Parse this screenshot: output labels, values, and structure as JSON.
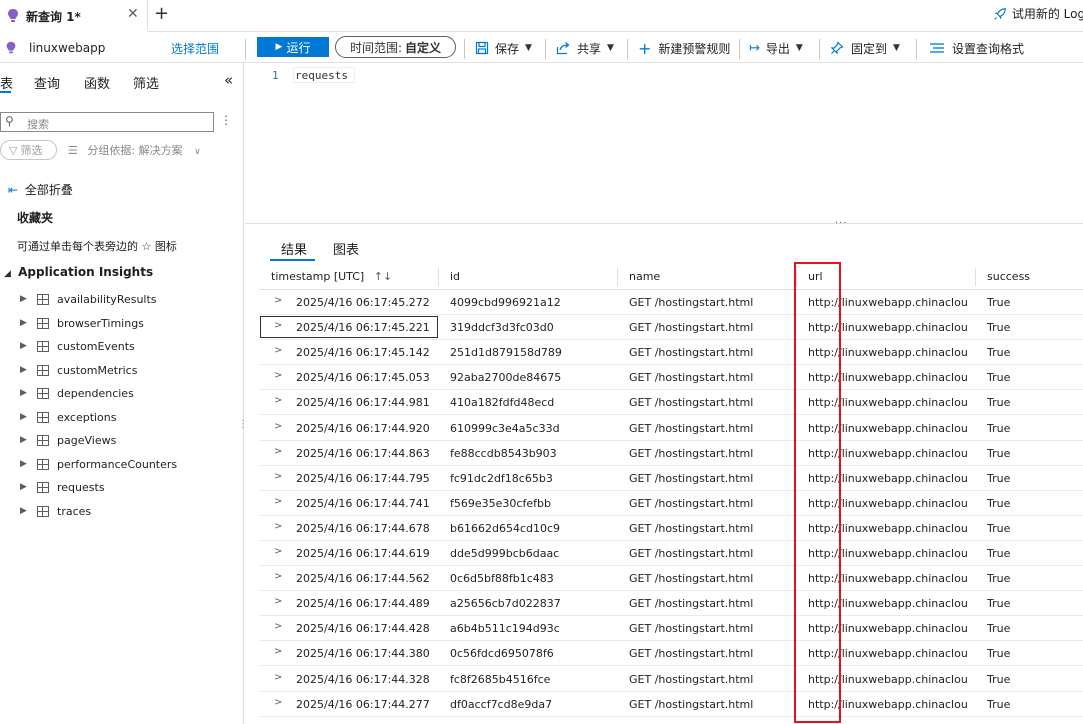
{
  "tabbar": {
    "tab_title": "新查询 1*",
    "close_glyph": "✕",
    "add_glyph": "+",
    "try_new": "试用新的 Log"
  },
  "toolbar": {
    "scope": "linuxwebapp",
    "select_scope": "选择范围",
    "run": "运行",
    "time_range_label": "时间范围:",
    "time_range_value": "自定义",
    "save": "保存",
    "share": "共享",
    "new_alert": "新建预警规则",
    "export": "导出",
    "pin": "固定到",
    "format": "设置查询格式"
  },
  "left": {
    "tabs": [
      "表",
      "查询",
      "函数",
      "筛选"
    ],
    "collapse_glyph": "«",
    "search_placeholder": "搜索",
    "filter": "筛选",
    "group_by": "分组依据: 解决方案",
    "collapse_all": "全部折叠",
    "favorites_title": "收藏夹",
    "favorites_hint": "可通过单击每个表旁边的 ☆ 图标",
    "section": "Application Insights",
    "tables": [
      "availabilityResults",
      "browserTimings",
      "customEvents",
      "customMetrics",
      "dependencies",
      "exceptions",
      "pageViews",
      "performanceCounters",
      "requests",
      "traces"
    ]
  },
  "editor": {
    "line_number": "1",
    "code": "requests"
  },
  "results": {
    "tabs": [
      "结果",
      "图表"
    ],
    "columns": [
      "timestamp [UTC]",
      "id",
      "name",
      "url",
      "success"
    ],
    "sort_glyph": "↑↓",
    "rows": [
      [
        "2025/4/16 06:17:45.272",
        "4099cbd996921a12",
        "GET /hostingstart.html",
        "http://linuxwebapp.chinaclouds...",
        "True"
      ],
      [
        "2025/4/16 06:17:45.221",
        "319ddcf3d3fc03d0",
        "GET /hostingstart.html",
        "http://linuxwebapp.chinaclouds...",
        "True"
      ],
      [
        "2025/4/16 06:17:45.142",
        "251d1d879158d789",
        "GET /hostingstart.html",
        "http://linuxwebapp.chinaclouds...",
        "True"
      ],
      [
        "2025/4/16 06:17:45.053",
        "92aba2700de84675",
        "GET /hostingstart.html",
        "http://linuxwebapp.chinaclouds...",
        "True"
      ],
      [
        "2025/4/16 06:17:44.981",
        "410a182fdfd48ecd",
        "GET /hostingstart.html",
        "http://linuxwebapp.chinaclouds...",
        "True"
      ],
      [
        "2025/4/16 06:17:44.920",
        "610999c3e4a5c33d",
        "GET /hostingstart.html",
        "http://linuxwebapp.chinaclouds...",
        "True"
      ],
      [
        "2025/4/16 06:17:44.863",
        "fe88ccdb8543b903",
        "GET /hostingstart.html",
        "http://linuxwebapp.chinaclouds...",
        "True"
      ],
      [
        "2025/4/16 06:17:44.795",
        "fc91dc2df18c65b3",
        "GET /hostingstart.html",
        "http://linuxwebapp.chinaclouds...",
        "True"
      ],
      [
        "2025/4/16 06:17:44.741",
        "f569e35e30cfefbb",
        "GET /hostingstart.html",
        "http://linuxwebapp.chinaclouds...",
        "True"
      ],
      [
        "2025/4/16 06:17:44.678",
        "b61662d654cd10c9",
        "GET /hostingstart.html",
        "http://linuxwebapp.chinaclouds...",
        "True"
      ],
      [
        "2025/4/16 06:17:44.619",
        "dde5d999bcb6daac",
        "GET /hostingstart.html",
        "http://linuxwebapp.chinaclouds...",
        "True"
      ],
      [
        "2025/4/16 06:17:44.562",
        "0c6d5bf88fb1c483",
        "GET /hostingstart.html",
        "http://linuxwebapp.chinaclouds...",
        "True"
      ],
      [
        "2025/4/16 06:17:44.489",
        "a25656cb7d022837",
        "GET /hostingstart.html",
        "http://linuxwebapp.chinaclouds...",
        "True"
      ],
      [
        "2025/4/16 06:17:44.428",
        "a6b4b511c194d93c",
        "GET /hostingstart.html",
        "http://linuxwebapp.chinaclouds...",
        "True"
      ],
      [
        "2025/4/16 06:17:44.380",
        "0c56fdcd695078f6",
        "GET /hostingstart.html",
        "http://linuxwebapp.chinaclouds...",
        "True"
      ],
      [
        "2025/4/16 06:17:44.328",
        "fc8f2685b4516fce",
        "GET /hostingstart.html",
        "http://linuxwebapp.chinaclouds...",
        "True"
      ],
      [
        "2025/4/16 06:17:44.277",
        "df0accf7cd8e9da7",
        "GET /hostingstart.html",
        "http://linuxwebapp.chinaclouds...",
        "True"
      ]
    ],
    "focused_row": 1
  },
  "colors": {
    "accent": "#0078d4",
    "highlight_box": "#e81123",
    "icon_purple": "#8661c5"
  },
  "icons": {
    "tab": "lightbulb-icon",
    "rocket": "rocket-icon",
    "run": "play-icon",
    "save": "save-icon",
    "share": "share-icon",
    "alert": "plus-icon",
    "export": "export-icon",
    "pin": "pin-icon",
    "format": "format-icon",
    "search": "search-icon",
    "filter": "funnel-icon",
    "group": "group-icon",
    "table": "table-icon"
  }
}
